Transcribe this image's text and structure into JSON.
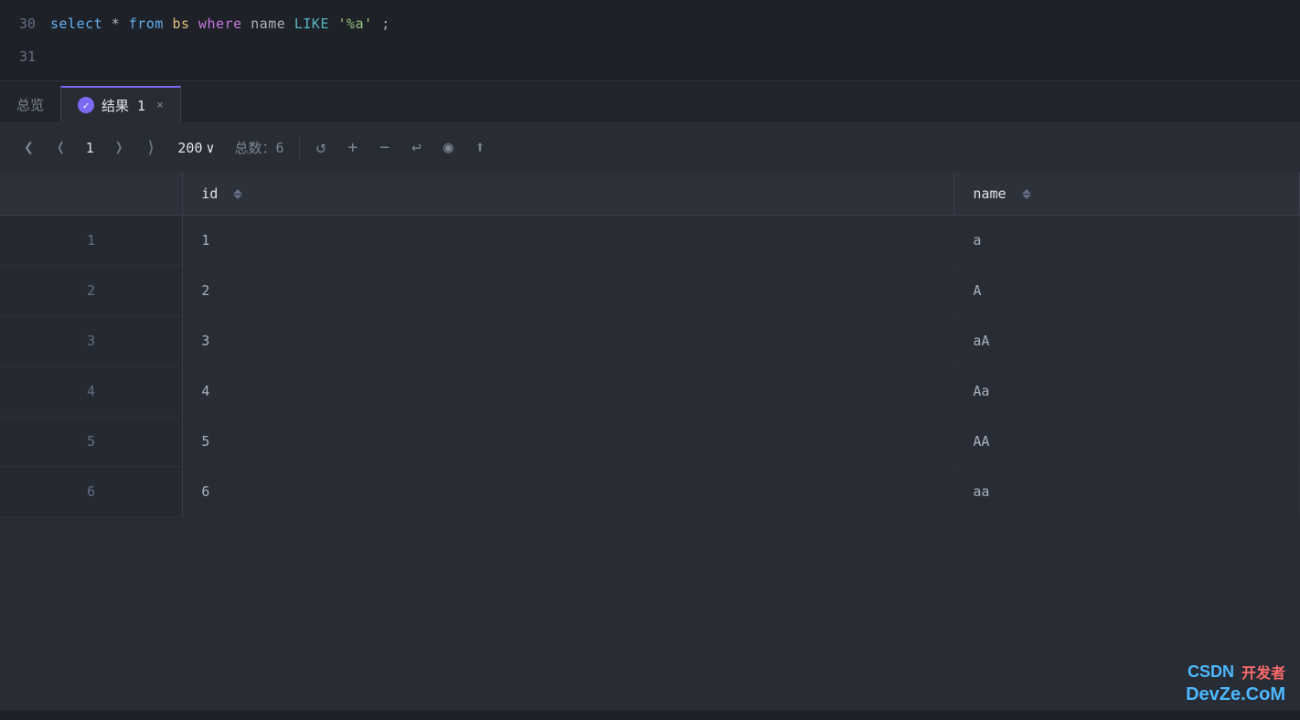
{
  "editor": {
    "lines": [
      {
        "number": "30",
        "tokens": [
          {
            "text": "select",
            "class": "kw-select"
          },
          {
            "text": " * ",
            "class": "kw-star"
          },
          {
            "text": "from",
            "class": "kw-from"
          },
          {
            "text": " bs ",
            "class": "kw-table"
          },
          {
            "text": "where",
            "class": "kw-where"
          },
          {
            "text": " name ",
            "class": "kw-name"
          },
          {
            "text": "LIKE",
            "class": "kw-like"
          },
          {
            "text": " ",
            "class": ""
          },
          {
            "text": "'%a'",
            "class": "kw-string"
          },
          {
            "text": ";",
            "class": "kw-semi"
          }
        ]
      },
      {
        "number": "31",
        "tokens": []
      }
    ]
  },
  "tabs": {
    "overview_label": "总览",
    "result_label": "结果 1",
    "close_icon": "×"
  },
  "toolbar": {
    "page_prev_prev": "⟨",
    "page_prev": "‹",
    "page_number": "1",
    "page_next": "›",
    "page_next_next": "›|",
    "page_size": "200",
    "page_size_arrow": "∨",
    "total_label": "总数：6",
    "refresh_icon": "↺",
    "add_icon": "+",
    "remove_icon": "−",
    "undo_icon": "↩",
    "view_icon": "◉",
    "upload_icon": "⬆"
  },
  "table": {
    "columns": [
      {
        "key": "row_num",
        "label": "",
        "sortable": false
      },
      {
        "key": "id",
        "label": "id",
        "sortable": true
      },
      {
        "key": "name",
        "label": "name",
        "sortable": true
      }
    ],
    "rows": [
      {
        "row_num": "1",
        "id": "1",
        "name": "a"
      },
      {
        "row_num": "2",
        "id": "2",
        "name": "A"
      },
      {
        "row_num": "3",
        "id": "3",
        "name": "aA"
      },
      {
        "row_num": "4",
        "id": "4",
        "name": "Aa"
      },
      {
        "row_num": "5",
        "id": "5",
        "name": "AA"
      },
      {
        "row_num": "6",
        "id": "6",
        "name": "aa"
      }
    ]
  },
  "watermark": {
    "csdn": "CSDN",
    "devze": "DevZe.CoM",
    "top": "开发者"
  }
}
